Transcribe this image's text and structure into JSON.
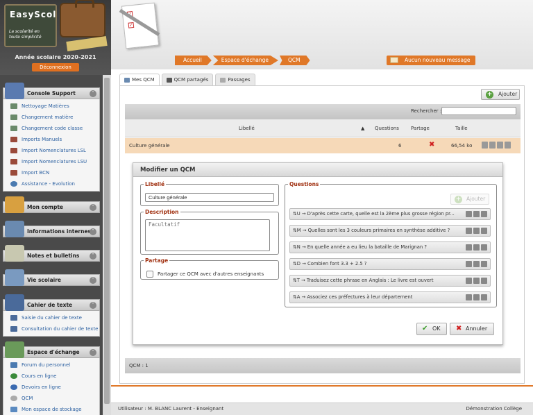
{
  "sidebar": {
    "logo_title": "EasyScol",
    "logo_subtitle": "La scolarité en toute simplicité",
    "school_year": "Année scolaire 2020-2021",
    "logout_label": "Déconnexion",
    "menus": [
      {
        "title": "Console Support",
        "expanded": true,
        "items": [
          "Nettoyage Matières",
          "Changement matière",
          "Changement code classe",
          "Imports Manuels",
          "Import Nomenclatures LSL",
          "Import Nomenclatures LSU",
          "Import BCN",
          "Assistance - Evolution"
        ]
      },
      {
        "title": "Mon compte",
        "expanded": false,
        "items": []
      },
      {
        "title": "Informations internes",
        "expanded": false,
        "items": []
      },
      {
        "title": "Notes et bulletins",
        "expanded": false,
        "items": []
      },
      {
        "title": "Vie scolaire",
        "expanded": false,
        "items": []
      },
      {
        "title": "Cahier de texte",
        "expanded": true,
        "items": [
          "Saisie du cahier de texte",
          "Consultation du cahier de texte"
        ]
      },
      {
        "title": "Espace d'échange",
        "expanded": true,
        "items": [
          "Forum du personnel",
          "Cours en ligne",
          "Devoirs en ligne",
          "QCM",
          "Mon espace de stockage"
        ]
      }
    ]
  },
  "breadcrumb": [
    "Accueil",
    "Espace d'échange",
    "QCM"
  ],
  "messages_label": "Aucun nouveau message",
  "tabs": [
    "Mes QCM",
    "QCM partagés",
    "Passages"
  ],
  "toolbar": {
    "add_label": "Ajouter",
    "search_label": "Rechercher :",
    "search_value": ""
  },
  "table": {
    "headers": {
      "label": "Libellé",
      "questions": "Questions",
      "share": "Partage",
      "size": "Taille"
    },
    "rows": [
      {
        "label": "Culture générale",
        "questions": "6",
        "size": "66,54 ko"
      }
    ],
    "footer": "QCM : 1"
  },
  "dialog": {
    "title": "Modifier un QCM",
    "label_legend": "Libellé",
    "label_value": "Culture générale",
    "description_legend": "Description",
    "description_placeholder": "Facultatif",
    "share_legend": "Partage",
    "share_checkbox_label": "Partager ce QCM avec d'autres enseignants",
    "questions_legend": "Questions",
    "questions_add_label": "Ajouter",
    "questions": [
      "⇅U → D'après cette carte, quelle est la 2ème plus grosse région pr...",
      "⇅M → Quelles sont les 3 couleurs primaires en synthèse additive ?",
      "⇅N → En quelle année a eu lieu la bataille de Marignan ?",
      "⇅D → Combien font 3.3 + 2.5 ?",
      "⇅T → Traduisez cette phrase en Anglais : Le livre est ouvert",
      "⇅A → Associez ces préfectures à leur département"
    ],
    "ok_label": "OK",
    "cancel_label": "Annuler"
  },
  "status": {
    "user": "Utilisateur : M. BLANC Laurent - Enseignant",
    "mode": "Démonstration Collège"
  },
  "colors": {
    "accent": "#e07828",
    "selected_row": "#f6d9b8",
    "legend": "#a03010"
  }
}
